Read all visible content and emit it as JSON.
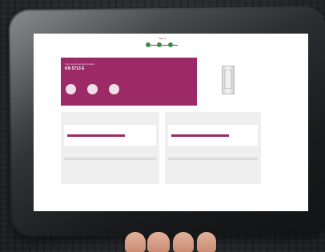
{
  "scene": {
    "description_icon": "tablet-photo",
    "accent_color": "#9c2a66",
    "step_color": "#3e8a4c"
  },
  "stepper": {
    "label": "Step 4",
    "steps_total": 3
  },
  "hero": {
    "small_text": "Your recommended product",
    "title": "KN 5713 E",
    "subtitle": "",
    "icons": [
      {
        "name": "energy-icon",
        "label": ""
      },
      {
        "name": "capacity-icon",
        "label": ""
      },
      {
        "name": "settings-icon",
        "label": ""
      }
    ]
  },
  "product": {
    "image_icon": "refrigerator-icon"
  },
  "cards": [
    {
      "title": "",
      "tag": "",
      "value": "",
      "sub": "",
      "label2": "",
      "value2": "",
      "sub2": ""
    },
    {
      "title": "",
      "tag": "",
      "value": "",
      "sub": "",
      "label2": "",
      "value2": "",
      "sub2": ""
    }
  ]
}
